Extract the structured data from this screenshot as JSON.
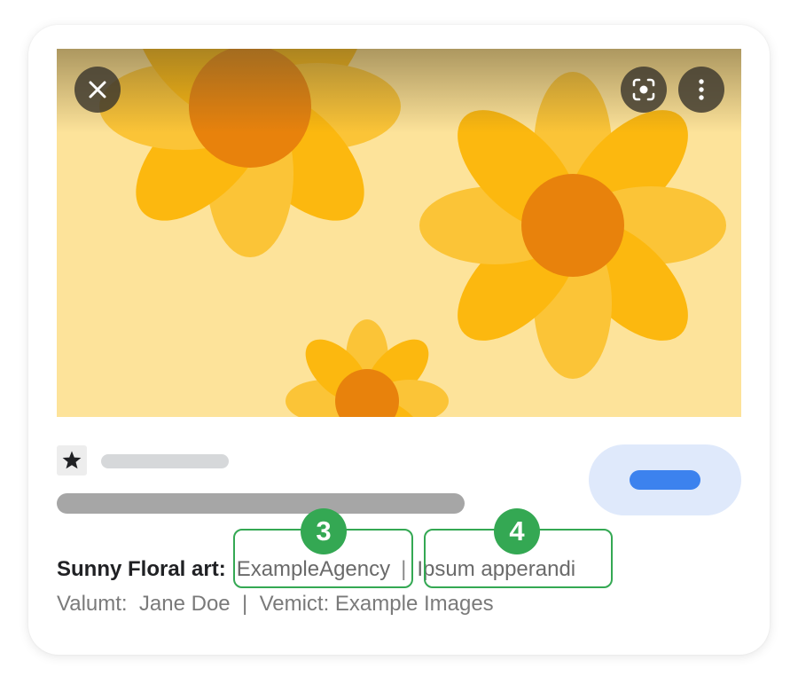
{
  "image": {
    "background_color": "#fde39a",
    "petal_colors": [
      "#fcb80f",
      "#fbc437"
    ],
    "center_color": "#e8820c",
    "controls": {
      "close_icon": "close-icon",
      "lens_icon": "lens-icon",
      "more_icon": "more-vert-icon"
    }
  },
  "result": {
    "source_icon": "star-icon",
    "visit_button_color": "#3c82ee"
  },
  "credit": {
    "label": "Sunny Floral art:",
    "creator": "ExampleAgency",
    "separator": "|",
    "license": "Ipsum apperandi"
  },
  "meta": {
    "line": "Valumt:  Jane Doe  |  Vemict: Example Images"
  },
  "annotations": [
    {
      "number": "3",
      "color": "#34a853"
    },
    {
      "number": "4",
      "color": "#34a853"
    }
  ]
}
